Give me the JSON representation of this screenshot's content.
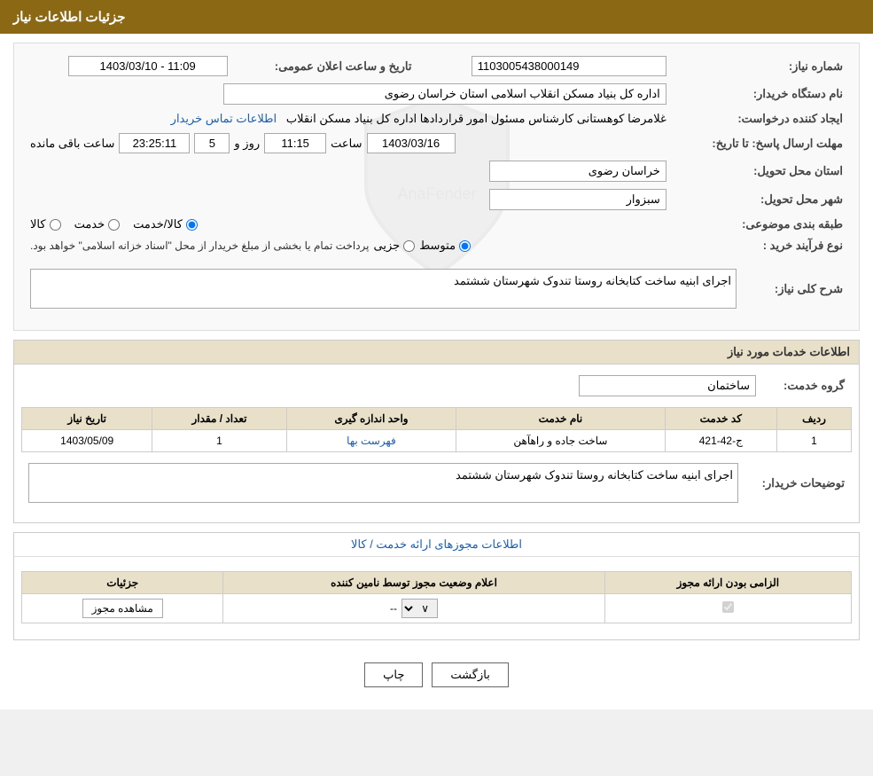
{
  "page": {
    "title": "جزئیات اطلاعات نیاز",
    "header": {
      "title": "جزئیات اطلاعات نیاز"
    }
  },
  "general_info": {
    "label": "تاریخ و ساعت اعلان عمومی:",
    "need_number_label": "شماره نیاز:",
    "need_number_value": "1103005438000149",
    "announce_date_label": "تاریخ و ساعت اعلان عمومی:",
    "announce_date_value": "1403/03/10 - 11:09",
    "buyer_org_label": "نام دستگاه خریدار:",
    "buyer_org_value": "اداره کل بنیاد مسکن انقلاب اسلامی استان خراسان رضوی",
    "creator_label": "ایجاد کننده درخواست:",
    "creator_value": "غلامرضا کوهستانی کارشناس مسئول امور قراردادها اداره کل بنیاد مسکن انقلاب",
    "contact_link": "اطلاعات تماس خریدار",
    "response_deadline_label": "مهلت ارسال پاسخ: تا تاریخ:",
    "response_date_value": "1403/03/16",
    "response_time_value": "11:15",
    "response_days_value": "5",
    "response_remaining_value": "23:25:11",
    "province_label": "استان محل تحویل:",
    "province_value": "خراسان رضوی",
    "city_label": "شهر محل تحویل:",
    "city_value": "سبزوار",
    "category_label": "طبقه بندی موضوعی:",
    "category_options": [
      "کالا",
      "خدمت",
      "کالا/خدمت"
    ],
    "category_selected": "کالا/خدمت",
    "purchase_type_label": "نوع فرآیند خرید :",
    "purchase_type_options": [
      "جزیی",
      "متوسط"
    ],
    "purchase_type_note": "پرداخت تمام یا بخشی از مبلغ خریدار از محل \"اسناد خزانه اسلامی\" خواهد بود.",
    "need_desc_label": "شرح کلی نیاز:",
    "need_desc_value": "اجرای ابنیه ساخت کتابخانه روستا تندوک شهرستان ششتمد"
  },
  "services_info": {
    "section_title": "اطلاعات خدمات مورد نیاز",
    "service_group_label": "گروه خدمت:",
    "service_group_value": "ساختمان",
    "table_headers": {
      "row_num": "ردیف",
      "service_code": "کد خدمت",
      "service_name": "نام خدمت",
      "unit": "واحد اندازه گیری",
      "quantity": "تعداد / مقدار",
      "need_date": "تاریخ نیاز"
    },
    "table_rows": [
      {
        "row_num": "1",
        "service_code": "ج-42-421",
        "service_name": "ساخت جاده و راهآهن",
        "unit": "فهرست بها",
        "quantity": "1",
        "need_date": "1403/05/09"
      }
    ],
    "buyer_notes_label": "توضیحات خریدار:",
    "buyer_notes_value": "اجرای ابنیه ساخت کتابخانه روستا تندوک شهرستان ششتمد"
  },
  "permits_info": {
    "section_title": "اطلاعات مجوزهای ارائه خدمت / کالا",
    "table_headers": {
      "required": "الزامی بودن ارائه مجوز",
      "supplier_status": "اعلام وضعیت مجوز توسط نامین کننده",
      "details": "جزئیات"
    },
    "table_rows": [
      {
        "required": true,
        "supplier_status": "--",
        "details": "مشاهده مجوز"
      }
    ]
  },
  "buttons": {
    "print": "چاپ",
    "back": "بازگشت"
  }
}
